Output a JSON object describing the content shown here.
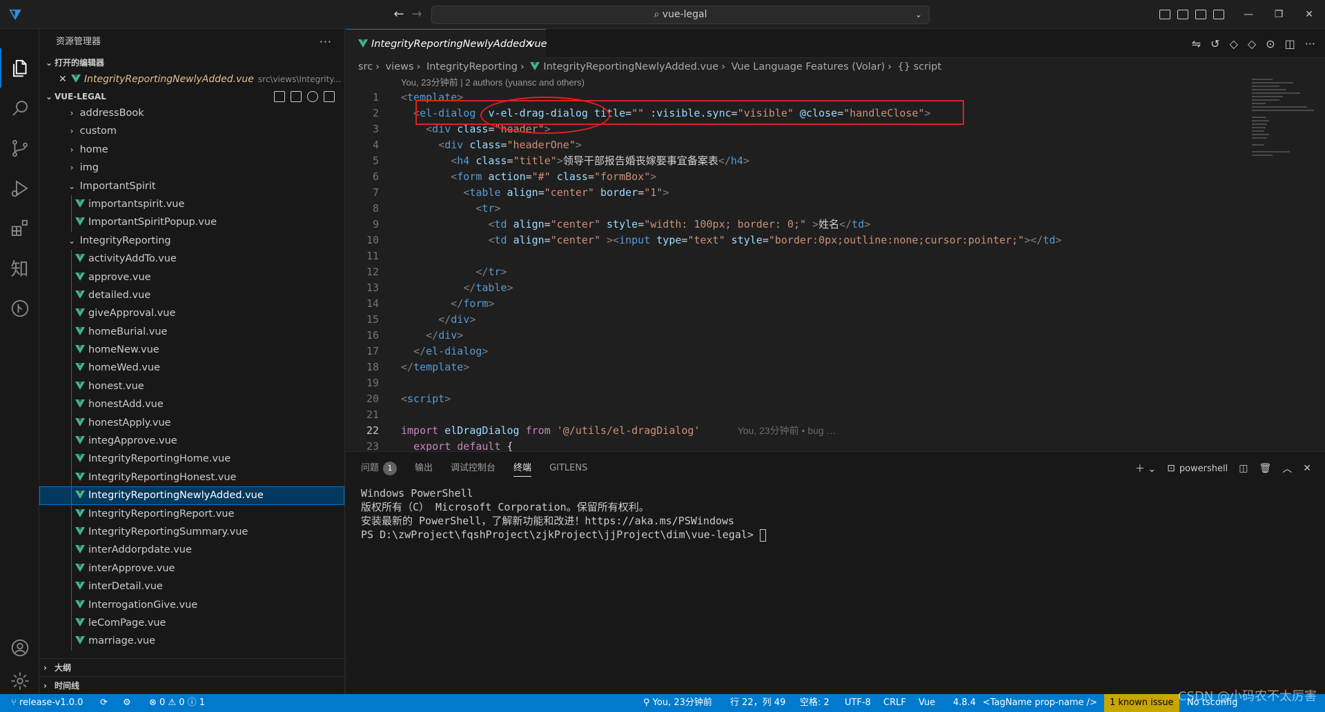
{
  "titlebar": {
    "search": "vue-legal",
    "back": "←",
    "forward": "→",
    "minimize": "—",
    "restore": "❐",
    "close": "✕"
  },
  "sidebar": {
    "title": "资源管理器",
    "open_editors_title": "打开的编辑器",
    "open_file": "IntegrityReportingNewlyAdded.vue",
    "open_file_path": "src\\views\\Integrity...",
    "project_title": "VUE-LEGAL",
    "folders": [
      "addressBook",
      "custom",
      "home",
      "img"
    ],
    "important_folder": "ImportantSpirit",
    "important_files": [
      "importantspirit.vue",
      "ImportantSpiritPopup.vue"
    ],
    "integrity_folder": "IntegrityReporting",
    "integrity_files": [
      "activityAddTo.vue",
      "approve.vue",
      "detailed.vue",
      "giveApproval.vue",
      "homeBurial.vue",
      "homeNew.vue",
      "homeWed.vue",
      "honest.vue",
      "honestAdd.vue",
      "honestApply.vue",
      "integApprove.vue",
      "IntegrityReportingHome.vue",
      "IntegrityReportingHonest.vue",
      "IntegrityReportingNewlyAdded.vue",
      "IntegrityReportingReport.vue",
      "IntegrityReportingSummary.vue",
      "interAddorpdate.vue",
      "interApprove.vue",
      "interDetail.vue",
      "InterrogationGive.vue",
      "leComPage.vue",
      "marriage.vue"
    ],
    "outline": "大纲",
    "timeline": "时间线"
  },
  "editor": {
    "tab": "IntegrityReportingNewlyAdded.vue",
    "breadcrumb": [
      "src",
      "views",
      "IntegrityReporting",
      "IntegrityReportingNewlyAdded.vue",
      "Vue Language Features (Volar)",
      "{} script"
    ],
    "codelens": "You, 23分钟前 | 2 authors (yuansc and others)",
    "line_numbers": [
      "1",
      "2",
      "3",
      "4",
      "5",
      "6",
      "7",
      "8",
      "9",
      "10",
      "11",
      "12",
      "13",
      "14",
      "15",
      "16",
      "17",
      "18",
      "19",
      "20",
      "21",
      "22",
      "23"
    ],
    "blame": "You, 23分钟前 • bug …"
  },
  "panel": {
    "tabs": [
      "问题",
      "输出",
      "调试控制台",
      "终端",
      "GITLENS"
    ],
    "problems_count": "1",
    "shell": "powershell",
    "terminal_lines": [
      "Windows PowerShell",
      "版权所有（C） Microsoft Corporation。保留所有权利。",
      "",
      "安装最新的 PowerShell，了解新功能和改进！https://aka.ms/PSWindows",
      "",
      "PS D:\\zwProject\\fqshProject\\zjkProject\\jjProject\\dim\\vue-legal> "
    ]
  },
  "statusbar": {
    "branch": "release-v1.0.0",
    "problems": "⊗ 0 ⚠ 0 ⓘ 1",
    "blame": "You, 23分钟前",
    "position": "行 22，列 49",
    "spaces": "空格: 2",
    "encoding": "UTF-8",
    "eol": "CRLF",
    "language": "Vue",
    "version": "4.8.4",
    "tag": "<TagName prop-name />",
    "issue": "1 known issue",
    "tsconfig": "No tsconfig"
  },
  "watermark": "CSDN @小码农不太厉害",
  "colors": {
    "accent": "#007acc",
    "annotation": "#e02020",
    "vue": "#41b883"
  }
}
